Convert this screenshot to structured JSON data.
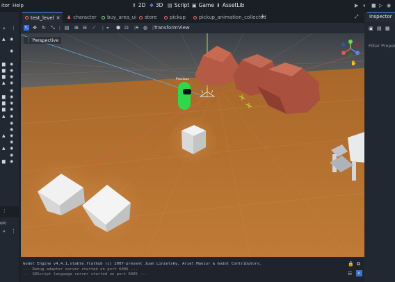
{
  "menu": {
    "items": [
      "itor",
      "Help"
    ]
  },
  "workspaces": [
    {
      "label": "2D",
      "icon": "2d-icon",
      "active": false
    },
    {
      "label": "3D",
      "icon": "3d-icon",
      "active": true
    },
    {
      "label": "Script",
      "icon": "script-icon",
      "active": false
    },
    {
      "label": "Game",
      "icon": "game-icon",
      "active": false
    },
    {
      "label": "AssetLib",
      "icon": "assetlib-icon",
      "active": false
    }
  ],
  "tabs": [
    {
      "label": "test_level",
      "color": "#ff6a6a",
      "active": true
    },
    {
      "label": "character",
      "color": "#ff6a6a"
    },
    {
      "label": "buy_area_ui",
      "color": "#7ee07e"
    },
    {
      "label": "store",
      "color": "#ff6a6a"
    },
    {
      "label": "pickup",
      "color": "#ff6a6a"
    },
    {
      "label": "pickup_animation_collected",
      "color": "#ff6a6a"
    }
  ],
  "toolbar": {
    "transform_label": "Transform",
    "view_label": "View"
  },
  "viewport": {
    "perspective_label": "Perspective",
    "character_label": "Precious"
  },
  "inspector": {
    "title": "Inspector",
    "filter_placeholder": "Filter Propert"
  },
  "left_panel": {
    "label": "urc"
  },
  "output": {
    "lines": [
      "Godot Engine v4.4.1.stable.flathub (c) 2007-present Juan Linietsky, Ariel Manzur & Godot Contributors.",
      "--- Debug adapter server started on port 6006 ---",
      "--- GDScript language server started on port 6005 ---"
    ]
  },
  "colors": {
    "accent": "#4f8cff",
    "ground": "#b87532",
    "rock": "#b55a45"
  }
}
